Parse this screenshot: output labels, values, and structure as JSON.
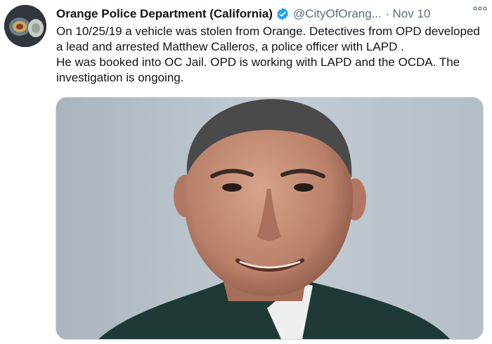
{
  "tweet": {
    "author": {
      "display_name": "Orange Police Department (California)",
      "verified_icon": "verified-badge-icon",
      "handle": "@CityOfOrang...",
      "avatar": "police-patch-avatar"
    },
    "separator": "·",
    "date": "Nov 10",
    "more_icon": "more-dots-icon",
    "text": "On 10/25/19 a vehicle was stolen from Orange.  Detectives from OPD developed a lead and arrested Matthew Calleros, a police officer with LAPD .\n  He was booked into OC Jail.  OPD is working with LAPD and the OCDA. The investigation is ongoing.",
    "media": {
      "type": "photo",
      "subject": "booking-photo"
    }
  },
  "colors": {
    "text": "#0f1419",
    "secondary": "#5b7083",
    "verified": "#1da1f2",
    "photo_background": "#b7c1cb"
  }
}
